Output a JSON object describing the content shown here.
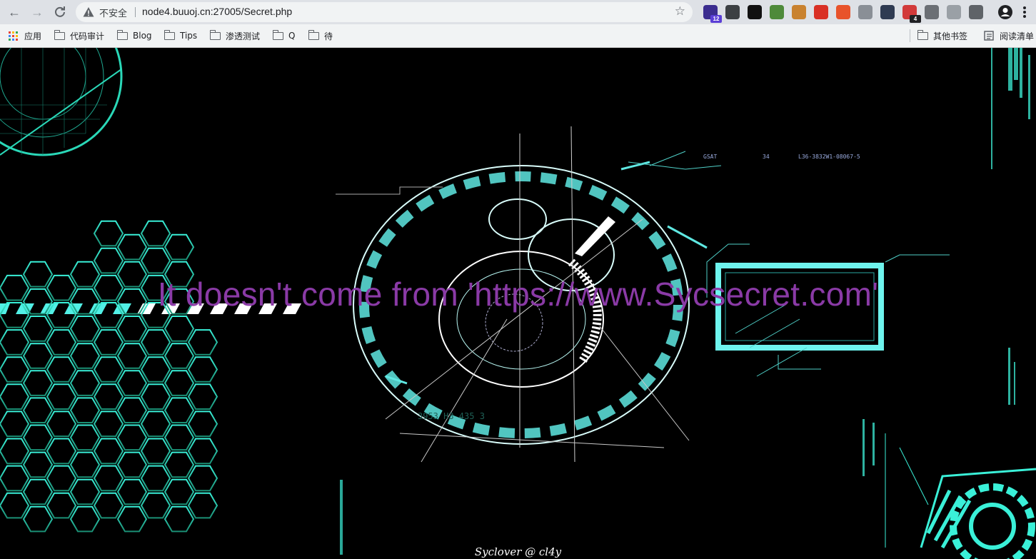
{
  "browser": {
    "security_label": "不安全",
    "url": "node4.buuoj.cn:27005/Secret.php",
    "extensions": [
      {
        "name": "extension-ar-icon",
        "color": "#3b2d8f",
        "badge": "12",
        "badge_color": "#5b3fd6"
      },
      {
        "name": "extension-gear-icon",
        "color": "#3c4043",
        "badge": "",
        "badge_color": ""
      },
      {
        "name": "extension-h-icon",
        "color": "#111111",
        "badge": "",
        "badge_color": ""
      },
      {
        "name": "extension-leaf-icon",
        "color": "#4e8a3a",
        "badge": "",
        "badge_color": ""
      },
      {
        "name": "extension-cookie-icon",
        "color": "#c9822f",
        "badge": "",
        "badge_color": ""
      },
      {
        "name": "extension-redirect-icon",
        "color": "#d93025",
        "badge": "",
        "badge_color": ""
      },
      {
        "name": "extension-network-icon",
        "color": "#e8532b",
        "badge": "",
        "badge_color": ""
      },
      {
        "name": "extension-globe-icon",
        "color": "#8a8f96",
        "badge": "",
        "badge_color": ""
      },
      {
        "name": "extension-circle-icon",
        "color": "#2f3b52",
        "badge": "",
        "badge_color": ""
      },
      {
        "name": "extension-proxy-icon",
        "color": "#d23a3a",
        "badge": "4",
        "badge_color": "#202124"
      },
      {
        "name": "extension-arrow-icon",
        "color": "#6b6f75",
        "badge": "",
        "badge_color": ""
      },
      {
        "name": "extension-target-icon",
        "color": "#9aa0a6",
        "badge": "",
        "badge_color": ""
      },
      {
        "name": "extensions-puzzle-icon",
        "color": "#5f6368",
        "badge": "",
        "badge_color": ""
      }
    ]
  },
  "bookmarks": {
    "apps_label": "应用",
    "items": [
      "代码审计",
      "Blog",
      "Tips",
      "渗透测试",
      "Q",
      "待"
    ],
    "other_label": "其他书签",
    "reading_label": "阅读清单"
  },
  "page": {
    "headline": "It doesn't come from 'https://www.Sycsecret.com'",
    "footer": "Syclover @ cl4y",
    "hud_labels": {
      "gsat": "GSAT",
      "num": "34",
      "code": "L36-3832W1-08067-5",
      "low_code": "3953 H3 435 3"
    }
  },
  "colors": {
    "accent_cyan": "#34e8e0",
    "headline": "#8a3aa6",
    "hex_green": "#2fd6a0"
  }
}
